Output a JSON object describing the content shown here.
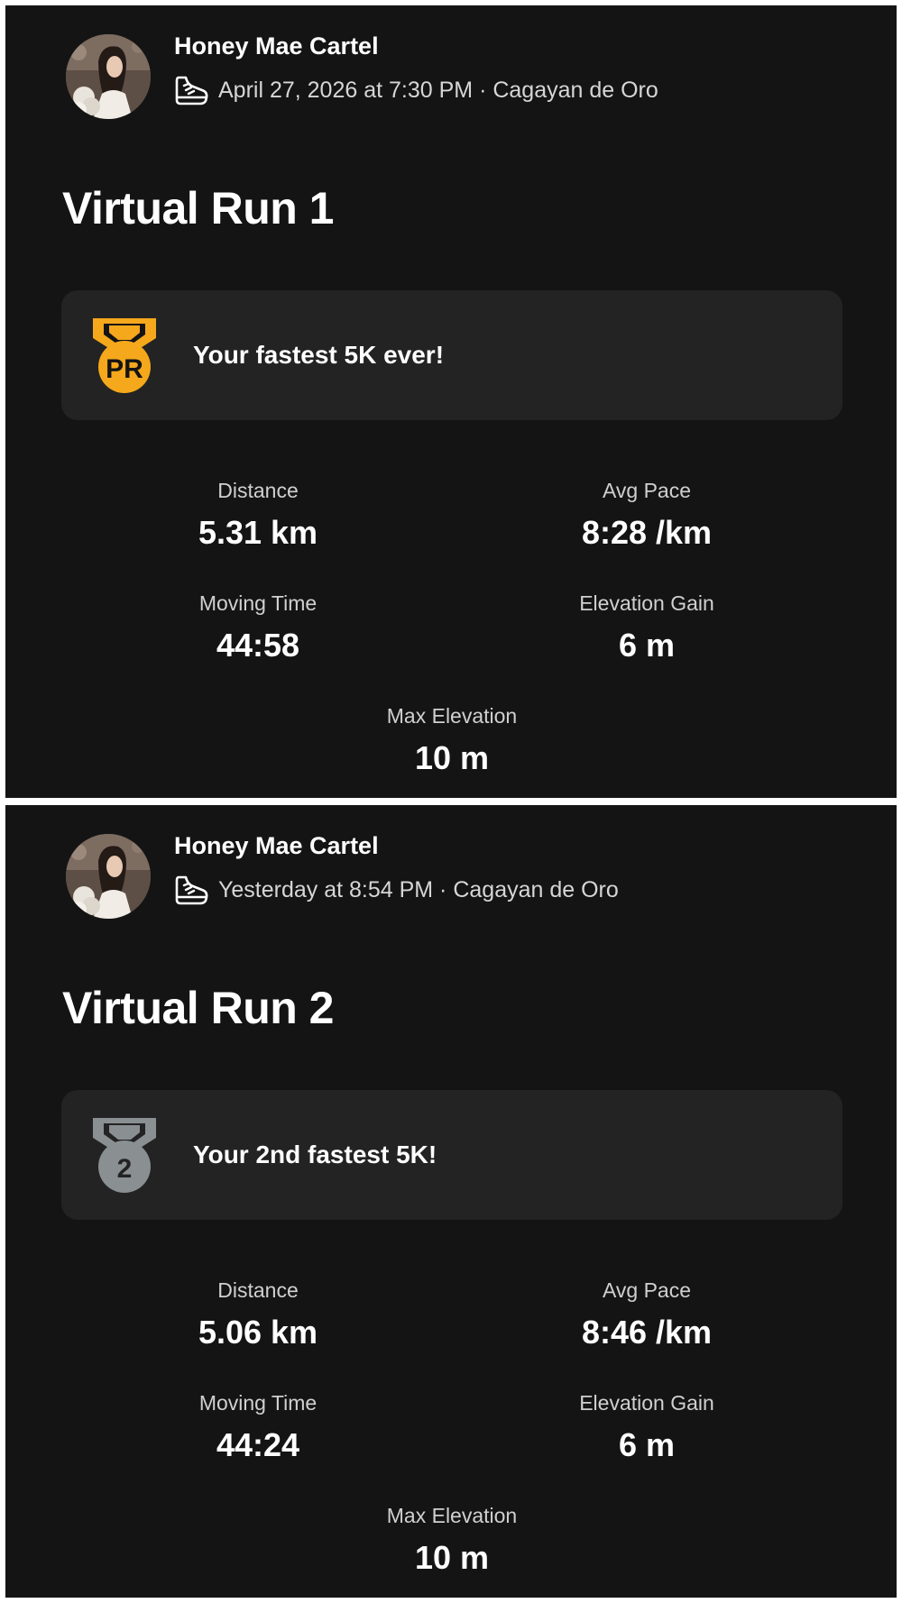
{
  "activities": [
    {
      "athlete_name": "Honey Mae Cartel",
      "activity_icon": "running-shoe-icon",
      "meta": "April 27, 2026 at 7:30 PM · Cagayan de Oro",
      "title": "Virtual Run 1",
      "achievement": {
        "badge_text": "PR",
        "badge_color": "#f5a81c",
        "text": "Your fastest 5K ever!"
      },
      "stats": {
        "distance": {
          "label": "Distance",
          "value": "5.31 km"
        },
        "avg_pace": {
          "label": "Avg Pace",
          "value": "8:28 /km"
        },
        "moving_time": {
          "label": "Moving Time",
          "value": "44:58"
        },
        "elevation_gain": {
          "label": "Elevation Gain",
          "value": "6 m"
        },
        "max_elevation": {
          "label": "Max Elevation",
          "value": "10 m"
        }
      }
    },
    {
      "athlete_name": "Honey Mae Cartel",
      "activity_icon": "running-shoe-icon",
      "meta": "Yesterday at 8:54 PM · Cagayan de Oro",
      "title": "Virtual Run 2",
      "achievement": {
        "badge_text": "2",
        "badge_color": "#8a8f92",
        "text": "Your 2nd fastest 5K!"
      },
      "stats": {
        "distance": {
          "label": "Distance",
          "value": "5.06 km"
        },
        "avg_pace": {
          "label": "Avg Pace",
          "value": "8:46 /km"
        },
        "moving_time": {
          "label": "Moving Time",
          "value": "44:24"
        },
        "elevation_gain": {
          "label": "Elevation Gain",
          "value": "6 m"
        },
        "max_elevation": {
          "label": "Max Elevation",
          "value": "10 m"
        }
      }
    }
  ]
}
